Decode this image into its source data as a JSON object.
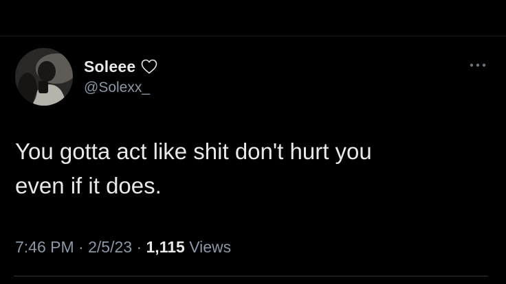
{
  "tweet": {
    "display_name": "Soleee",
    "handle": "@Solexx_",
    "text": "You gotta act like shit don't hurt you\neven if it does.",
    "time": "7:46 PM",
    "date": "2/5/23",
    "separator": "·",
    "views_count": "1,115",
    "views_label": "Views"
  },
  "icons": {
    "name_badge": "heart-outline-icon",
    "more": "more-horizontal-icon"
  },
  "colors": {
    "background": "#000000",
    "primary_text": "#e7e9ea",
    "secondary_text": "#8b98a5",
    "divider": "#2f3336"
  }
}
